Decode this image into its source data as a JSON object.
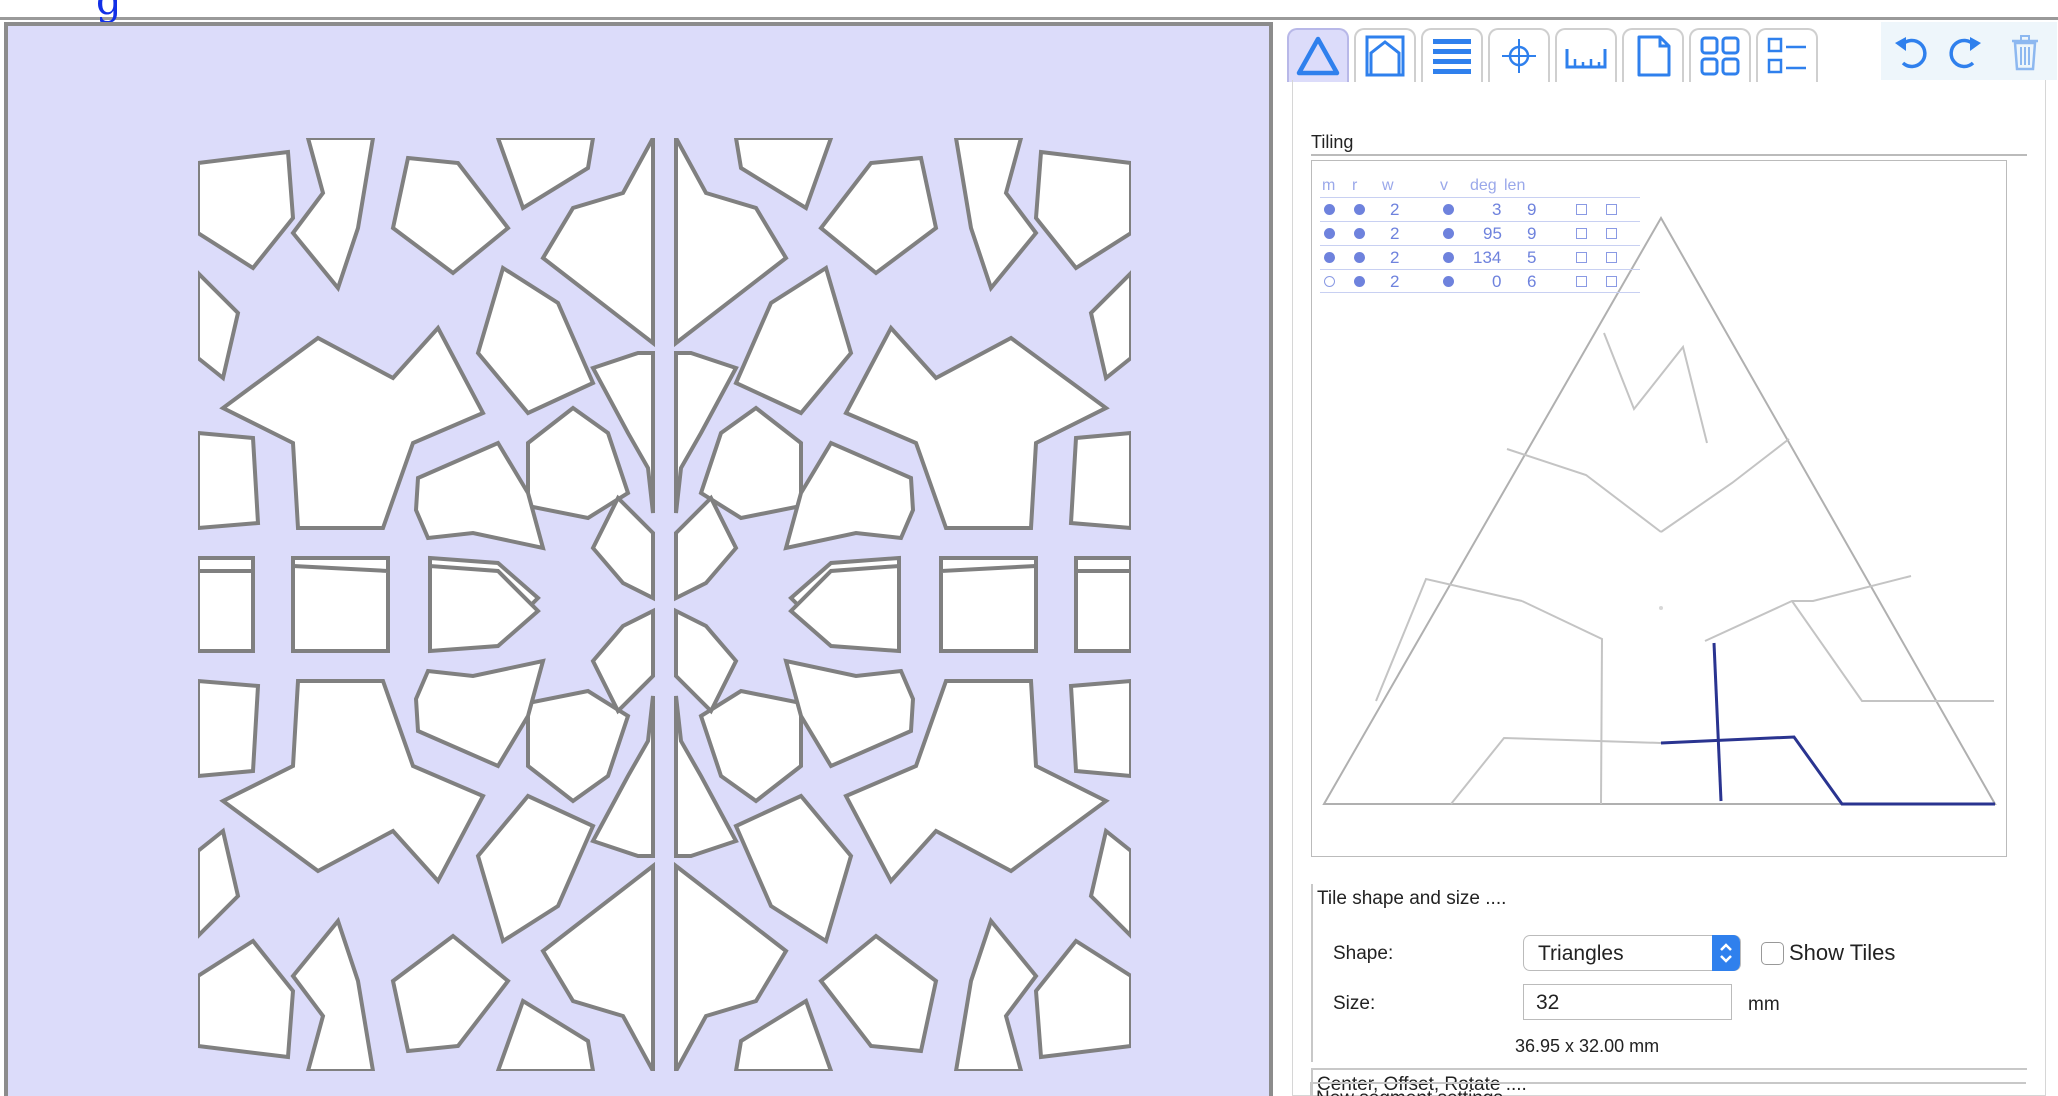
{
  "top": {
    "glyph": "g"
  },
  "toolbar": {
    "buttons": [
      {
        "icon": "triangle-tiling-icon"
      },
      {
        "icon": "house-shape-icon"
      },
      {
        "icon": "stripes-icon"
      },
      {
        "icon": "crosshair-icon"
      },
      {
        "icon": "ruler-icon"
      },
      {
        "icon": "document-icon"
      },
      {
        "icon": "grid-four-icon"
      },
      {
        "icon": "list-icon"
      }
    ],
    "undo_icon": "undo-icon",
    "redo_icon": "redo-icon",
    "delete_icon": "trash-icon"
  },
  "tiling": {
    "label": "Tiling",
    "columns": [
      "m",
      "r",
      "w",
      "v",
      "deg",
      "len"
    ],
    "rows": [
      {
        "m": "filled",
        "r": "filled",
        "w": "2",
        "v": "filled",
        "deg": "3",
        "len": "9"
      },
      {
        "m": "filled",
        "r": "filled",
        "w": "2",
        "v": "filled",
        "deg": "95",
        "len": "9"
      },
      {
        "m": "filled",
        "r": "filled",
        "w": "2",
        "v": "filled",
        "deg": "134",
        "len": "5"
      },
      {
        "m": "hollow",
        "r": "filled",
        "w": "2",
        "v": "filled",
        "deg": "0",
        "len": "6"
      }
    ]
  },
  "tile_shape": {
    "title": "Tile shape and size ....",
    "shape_label": "Shape:",
    "shape_value": "Triangles",
    "show_tiles_label": "Show Tiles",
    "show_tiles_checked": false,
    "size_label": "Size:",
    "size_value": "32",
    "size_unit": "mm",
    "dimensions": "36.95 x 32.00",
    "dimensions_unit": "mm"
  },
  "sections": {
    "center_offset_rotate": "Center, Offset, Rotate ....",
    "new_segment_settings": "New segment settings ...."
  },
  "colors": {
    "canvas_bg": "#dcdcfa",
    "pattern_stroke": "#808080",
    "accent": "#2f80ed",
    "segment_active": "#2a3490",
    "table_text": "#6e82dd"
  }
}
